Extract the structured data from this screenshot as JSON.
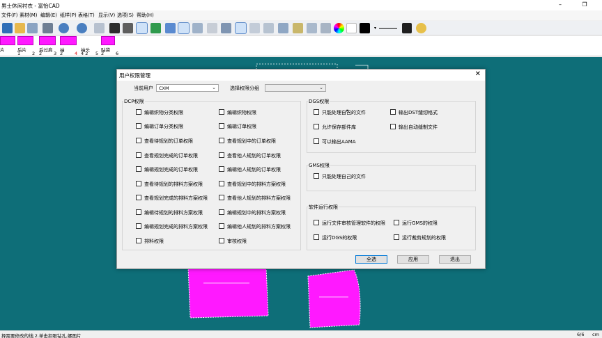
{
  "window": {
    "title": "男士休闲衬衣 - 富怡CAD"
  },
  "menu": [
    "文件(F)",
    "素材(M)",
    "编辑(E)",
    "纸样(P)",
    "表格(T)",
    "显示(V)",
    "选项(S)",
    "帮助(H)"
  ],
  "pieces": [
    {
      "name": "片",
      "num_a": "",
      "num_b": ""
    },
    {
      "name": "后片",
      "num_a": "1",
      "num_b": "2"
    },
    {
      "name": "后过肩",
      "num_a": "2",
      "num_b": "3"
    },
    {
      "name": "袖",
      "num_a": "2",
      "num_b": "4"
    },
    {
      "name": "袖头",
      "num_a": "4 2",
      "num_b": "5"
    },
    {
      "name": "贴袋",
      "num_a": "2",
      "num_b": "6"
    }
  ],
  "status": {
    "hint": "择需要修改的线;2.单击扣眼钻孔,螺图片",
    "page": "6/6",
    "unit": "cm"
  },
  "dialog": {
    "title": "用户权限管理",
    "close": "✕",
    "current_user_label": "当前用户",
    "current_user_value": "CXM",
    "group_select_label": "选择权限分组",
    "group_select_value": "",
    "dcp": {
      "title": "DCP权限",
      "left": [
        "编辑织物分类权限",
        "编辑订单分类权限",
        "查看待规划的订单权限",
        "查看规划完成的订单权限",
        "编辑规划完成的订单权限",
        "查看待规划的排料方案权限",
        "查看规划完成的排料方案权限",
        "编辑待规划的排料方案权限",
        "编辑规划完成的排料方案权限",
        "排料权限"
      ],
      "right": [
        "编辑织物权限",
        "编辑订单权限",
        "查看规划中的订单权限",
        "查看他人规划的订单权限",
        "编辑他人规划的订单权限",
        "查看规划中的排料方案权限",
        "查看他人规划的排料方案权限",
        "编辑规划中的排料方案权限",
        "编辑他人规划的排料方案权限",
        "审核权限"
      ]
    },
    "dgs": {
      "title": "DGS权限",
      "items": [
        "只能处理自己的文件",
        "允许保存部件库",
        "可以输出AAMA"
      ],
      "right_items": [
        "输出DST缝纫格式",
        "输出自动缝制文件"
      ]
    },
    "gms": {
      "title": "GMS权限",
      "items": [
        "只能处理自己的文件"
      ]
    },
    "software": {
      "title": "软件运行权限",
      "items": [
        "运行文件审核管理软件的权限",
        "运行DGS的权限"
      ],
      "right_items": [
        "运行GMS的权限",
        "运行裁剪规划的权限"
      ]
    },
    "buttons": {
      "select_all": "全选",
      "apply": "应用",
      "exit": "退出"
    }
  },
  "colors": {
    "canvas": "#0e6e78",
    "piece_fill": "#ff19ff",
    "toolbar_selected": "#cfe2f8"
  },
  "icons": [
    "new-file-icon",
    "open-file-icon",
    "save-icon",
    "print-icon",
    "undo-icon",
    "redo-icon",
    "measure-icon",
    "grid-icon",
    "layout-icon",
    "style-icon",
    "sigma-icon",
    "ruler-icon",
    "pen-icon",
    "color-wheel-icon",
    "help-icon"
  ]
}
